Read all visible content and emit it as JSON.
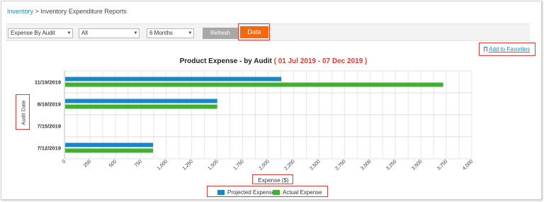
{
  "breadcrumb": {
    "link": "Inventory",
    "separator": ">",
    "current": "Inventory Expenditure Reports"
  },
  "toolbar": {
    "report_type": "Expense By Audit",
    "filter": "All",
    "period": "6 Months",
    "refresh_label": "Refresh",
    "data_label": "Data"
  },
  "favorites_label": "Add to Favorites",
  "colors": {
    "projected": "#1a86c4",
    "actual": "#3fb02f",
    "accent": "#f26a10",
    "highlight": "#e53935",
    "link": "#1e88c8"
  },
  "chart_data": {
    "type": "bar",
    "orientation": "horizontal",
    "title": "Product Expense - by Audit",
    "date_range": "01 Jul 2019 - 07 Dec 2019",
    "categories": [
      "11/19/2019",
      "8/18/2019",
      "7/15/2019",
      "7/12/2019"
    ],
    "series": [
      {
        "name": "Projected Expense",
        "values": [
          2130,
          1500,
          0,
          870
        ]
      },
      {
        "name": "Actual Expense",
        "values": [
          3720,
          1500,
          0,
          870
        ]
      }
    ],
    "xlabel": "Expense ($)",
    "ylabel": "Audit Date",
    "xlim": [
      0,
      4000
    ],
    "xticks": [
      "0",
      "250",
      "500",
      "750",
      "1,000",
      "1,250",
      "1,500",
      "1,750",
      "2,000",
      "2,250",
      "2,500",
      "2,750",
      "3,000",
      "3,250",
      "3,500",
      "3,750",
      "4,000"
    ],
    "grid": true,
    "legend_position": "bottom"
  }
}
